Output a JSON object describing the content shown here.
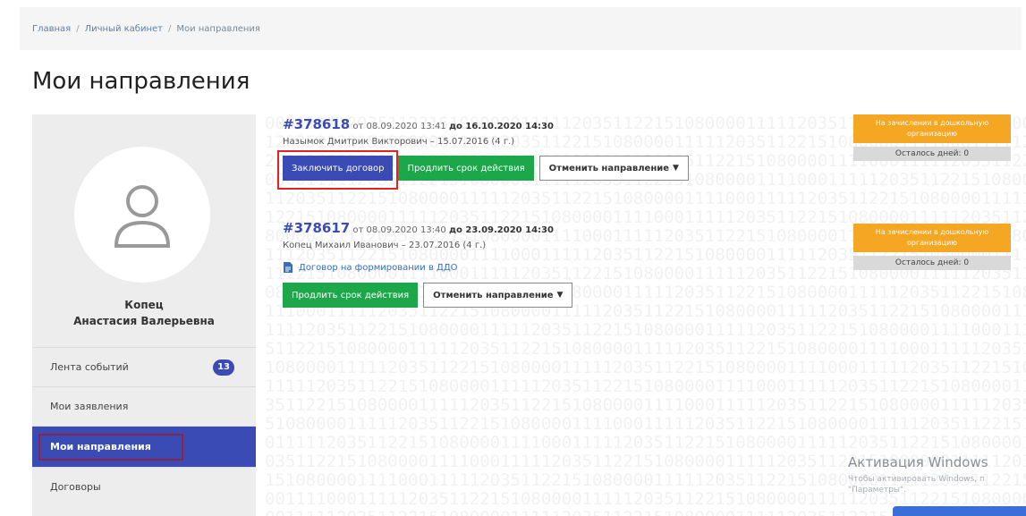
{
  "breadcrumb": {
    "items": [
      "Главная",
      "Личный кабинет",
      "Мои направления"
    ]
  },
  "page": {
    "title": "Мои направления"
  },
  "sidebar": {
    "user_name_line1": "Копец",
    "user_name_line2": "Анастасия Валерьевна",
    "items": [
      {
        "label": "Лента событий",
        "badge": "13"
      },
      {
        "label": "Мои заявления"
      },
      {
        "label": "Мои направления"
      },
      {
        "label": "Договоры"
      }
    ]
  },
  "referrals": [
    {
      "number": "#378618",
      "date_text": "от 08.09.2020 13:41",
      "until": "до 16.10.2020 14:30",
      "child": "Назымок Дмитрик Викторович – 15.07.2016 (4 г.)",
      "btn_contract": "Заключить договор",
      "btn_extend": "Продлить срок действия",
      "btn_cancel": "Отменить направление",
      "status": "На зачислении в дошкольную организацию",
      "days_left": "Осталось дней: 0"
    },
    {
      "number": "#378617",
      "date_text": "от 08.09.2020 13:40",
      "until": "до 23.09.2020 14:30",
      "child": "Копец Михаил Иванович – 23.07.2016 (4 г.)",
      "doc_link": "Договор на формировании в ДДО",
      "btn_extend": "Продлить срок действия",
      "btn_cancel": "Отменить направление",
      "status": "На зачислении в дошкольную организацию",
      "days_left": "Осталось дней: 0"
    }
  ],
  "windows": {
    "title": "Активация Windows",
    "subtitle_line1": "Чтобы активировать Windows, п",
    "subtitle_line2": "\"Параметры\"."
  },
  "colors": {
    "primary": "#3a4bb5",
    "green": "#1ca84a",
    "orange": "#f5a623",
    "highlight_red": "#e32323",
    "highlight_maroon": "#8a2448"
  }
}
